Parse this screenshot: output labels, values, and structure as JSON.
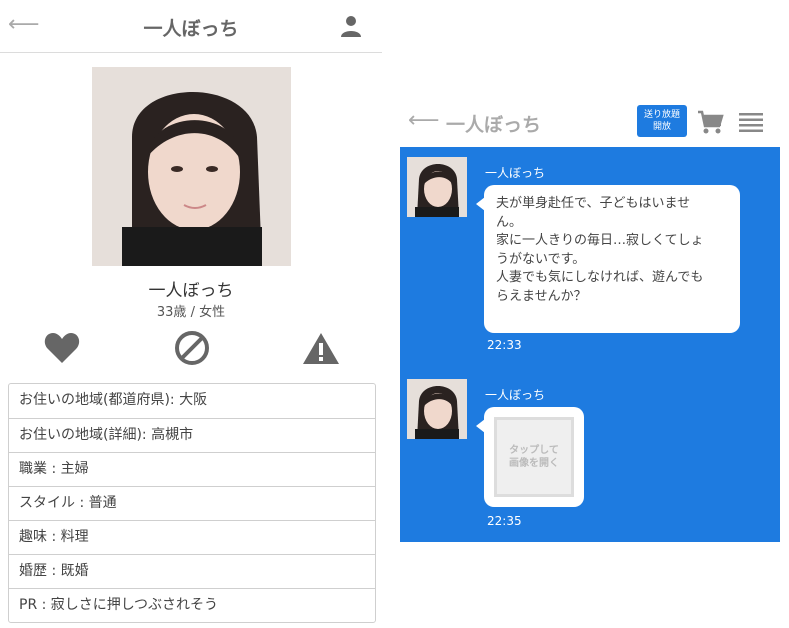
{
  "profile": {
    "header": {
      "back_icon": "arrow-left-icon",
      "title": "一人ぼっち",
      "user_icon": "user-icon"
    },
    "name": "一人ぼっち",
    "age": "33歳",
    "separator": "/",
    "gender": "女性",
    "actions": [
      "heart-icon",
      "block-icon",
      "warning-icon"
    ],
    "info_rows": [
      "お住いの地域(都道府県): 大阪",
      "お住いの地域(詳細): 高槻市",
      "職業 : 主婦",
      "スタイル : 普通",
      "趣味 : 料理",
      "婚歴 : 既婚",
      "PR : 寂しさに押しつぶされそう"
    ]
  },
  "chat": {
    "header": {
      "back_icon": "arrow-left-icon",
      "title": "一人ぼっち",
      "badge_line1": "送り放題",
      "badge_line2": "開放",
      "cart_icon": "cart-icon",
      "menu_icon": "menu-icon"
    },
    "messages": [
      {
        "sender": "一人ぼっち",
        "lines": [
          "夫が単身赴任で、子どもはいませ",
          "ん。",
          "家に一人きりの毎日…寂しくてしょ",
          "うがないです。",
          "人妻でも気にしなければ、遊んでも",
          "らえませんか？"
        ],
        "time": "22:33"
      },
      {
        "sender": "一人ぼっち",
        "image_label_line1": "タップして",
        "image_label_line2": "画像を開く",
        "time": "22:35"
      }
    ]
  },
  "colors": {
    "chat_bg": "#1e7be0",
    "badge_bg": "#1e7be0",
    "icon_gray": "#666666"
  }
}
